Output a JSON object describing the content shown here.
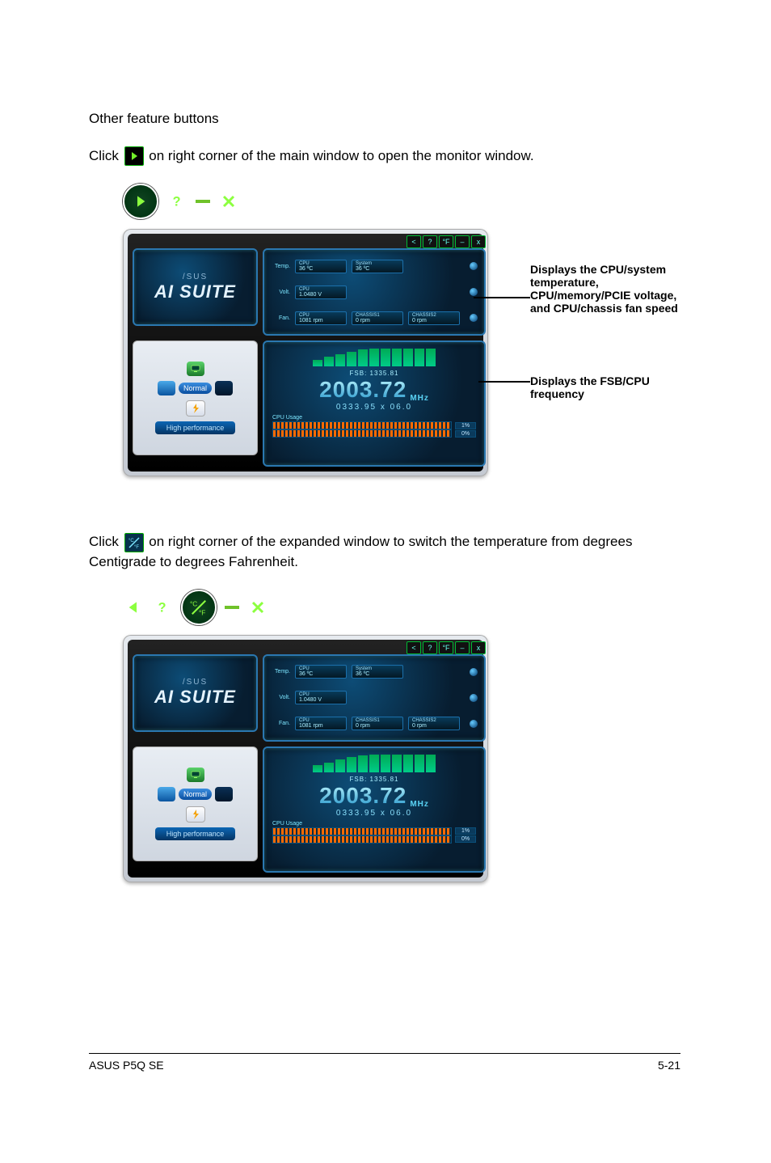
{
  "text": {
    "heading": "Other feature buttons",
    "para1_a": "Click ",
    "para1_b": " on right corner of the main window to open the monitor window.",
    "para2_a": "Click ",
    "para2_b": " on right corner of the expanded window to switch the temperature from degrees Centigrade to degrees Fahrenheit."
  },
  "annot": {
    "stats": "Displays the CPU/system temperature, CPU/memory/PCIE voltage, and CPU/chassis fan speed",
    "freq": "Displays the FSB/CPU frequency"
  },
  "ai_suite": {
    "brand": "/SUS",
    "title": "AI SUITE",
    "profile": "Normal",
    "perf": "High performance",
    "win_buttons": [
      "<",
      "?",
      "°F",
      "–",
      "x"
    ],
    "stats": {
      "temp": {
        "label": "Temp.",
        "items": [
          {
            "name": "CPU",
            "value": "36 ºC"
          },
          {
            "name": "System",
            "value": "36 ºC"
          }
        ]
      },
      "volt": {
        "label": "Volt.",
        "items": [
          {
            "name": "CPU",
            "value": "1.0480 V"
          }
        ]
      },
      "fan": {
        "label": "Fan.",
        "items": [
          {
            "name": "CPU",
            "value": "1081 rpm"
          },
          {
            "name": "CHASSIS1",
            "value": "0 rpm"
          },
          {
            "name": "CHASSIS2",
            "value": "0 rpm"
          }
        ]
      }
    },
    "freq": {
      "fsb_label": "FSB:",
      "fsb": "1335.81",
      "cpu": "2003.72",
      "unit": "MHz",
      "sub": "0333.95  x  06.0",
      "usage_label": "CPU Usage",
      "usage": [
        "1%",
        "0%"
      ]
    }
  },
  "footer": {
    "left": "ASUS P5Q SE",
    "right": "5-21"
  }
}
